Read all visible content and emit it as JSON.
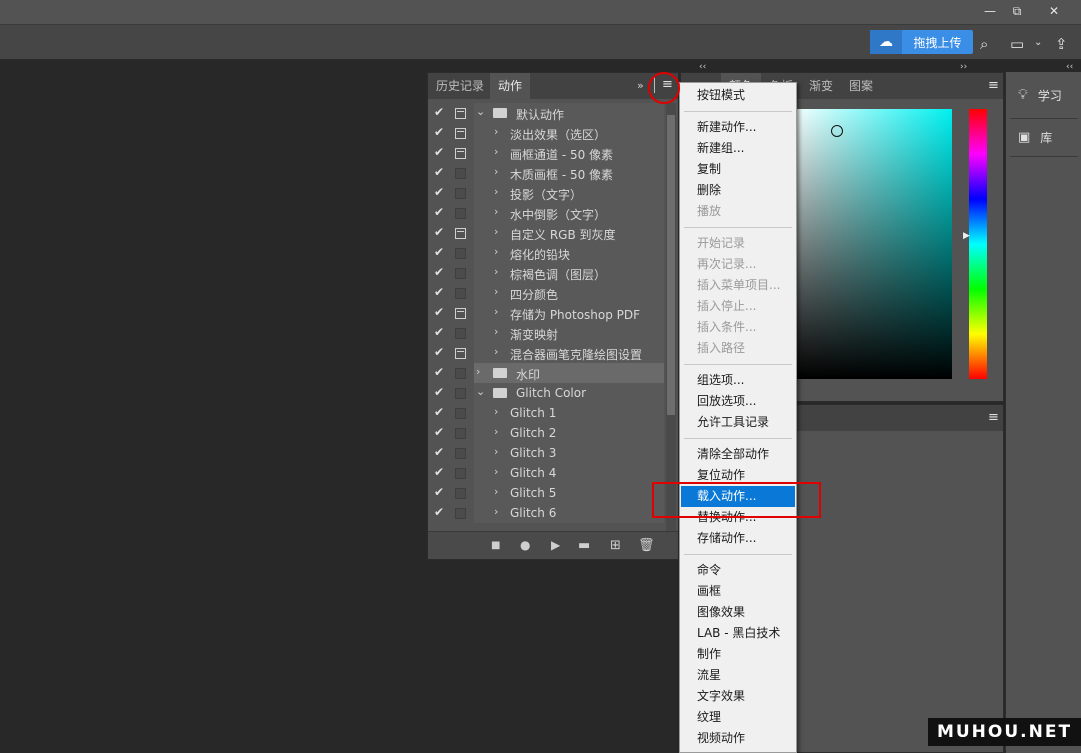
{
  "window": {
    "minimize": "—",
    "restore": "⧉",
    "close": "✕"
  },
  "options_bar": {
    "cloud_label": "拖拽上传"
  },
  "actions_panel": {
    "tabs": [
      "历史记录",
      "动作"
    ],
    "rows": [
      {
        "label": "默认动作",
        "checked": true,
        "dialog": true,
        "type": "set",
        "open": true
      },
      {
        "label": "淡出效果（选区）",
        "checked": true,
        "dialog": true,
        "type": "action"
      },
      {
        "label": "画框通道 - 50 像素",
        "checked": true,
        "dialog": true,
        "type": "action"
      },
      {
        "label": "木质画框 - 50 像素",
        "checked": true,
        "dialog": false,
        "type": "action"
      },
      {
        "label": "投影（文字）",
        "checked": true,
        "dialog": false,
        "type": "action"
      },
      {
        "label": "水中倒影（文字）",
        "checked": true,
        "dialog": false,
        "type": "action"
      },
      {
        "label": "自定义 RGB 到灰度",
        "checked": true,
        "dialog": true,
        "type": "action"
      },
      {
        "label": "熔化的铅块",
        "checked": true,
        "dialog": false,
        "type": "action"
      },
      {
        "label": "棕褐色调（图层）",
        "checked": true,
        "dialog": false,
        "type": "action"
      },
      {
        "label": "四分颜色",
        "checked": true,
        "dialog": false,
        "type": "action"
      },
      {
        "label": "存储为 Photoshop PDF",
        "checked": true,
        "dialog": true,
        "type": "action"
      },
      {
        "label": "渐变映射",
        "checked": true,
        "dialog": false,
        "type": "action"
      },
      {
        "label": "混合器画笔克隆绘图设置",
        "checked": true,
        "dialog": true,
        "type": "action"
      },
      {
        "label": "水印",
        "checked": true,
        "dialog": false,
        "type": "set",
        "open": false,
        "selected": true
      },
      {
        "label": "Glitch Color",
        "checked": true,
        "dialog": false,
        "type": "set",
        "open": true
      },
      {
        "label": "Glitch 1",
        "checked": true,
        "dialog": false,
        "type": "action"
      },
      {
        "label": "Glitch 2",
        "checked": true,
        "dialog": false,
        "type": "action"
      },
      {
        "label": "Glitch 3",
        "checked": true,
        "dialog": false,
        "type": "action"
      },
      {
        "label": "Glitch 4",
        "checked": true,
        "dialog": false,
        "type": "action"
      },
      {
        "label": "Glitch 5",
        "checked": true,
        "dialog": false,
        "type": "action"
      },
      {
        "label": "Glitch 6",
        "checked": true,
        "dialog": false,
        "type": "action"
      }
    ]
  },
  "color_panel": {
    "tabs": [
      "颜色",
      "色板",
      "渐变",
      "图案"
    ]
  },
  "right_dock": {
    "items": [
      "学习",
      "库"
    ]
  },
  "panel_menu": {
    "groups": [
      [
        {
          "label": "按钮模式",
          "enabled": true
        }
      ],
      [
        {
          "label": "新建动作...",
          "enabled": true
        },
        {
          "label": "新建组...",
          "enabled": true
        },
        {
          "label": "复制",
          "enabled": true
        },
        {
          "label": "删除",
          "enabled": true
        },
        {
          "label": "播放",
          "enabled": false
        }
      ],
      [
        {
          "label": "开始记录",
          "enabled": false
        },
        {
          "label": "再次记录...",
          "enabled": false
        },
        {
          "label": "插入菜单项目...",
          "enabled": false
        },
        {
          "label": "插入停止...",
          "enabled": false
        },
        {
          "label": "插入条件...",
          "enabled": false
        },
        {
          "label": "插入路径",
          "enabled": false
        }
      ],
      [
        {
          "label": "组选项...",
          "enabled": true
        },
        {
          "label": "回放选项...",
          "enabled": true
        },
        {
          "label": "允许工具记录",
          "enabled": true
        }
      ],
      [
        {
          "label": "清除全部动作",
          "enabled": true
        },
        {
          "label": "复位动作",
          "enabled": true
        },
        {
          "label": "载入动作...",
          "enabled": true,
          "highlighted": true
        },
        {
          "label": "替换动作...",
          "enabled": true
        },
        {
          "label": "存储动作...",
          "enabled": true
        }
      ],
      [
        {
          "label": "命令",
          "enabled": true
        },
        {
          "label": "画框",
          "enabled": true
        },
        {
          "label": "图像效果",
          "enabled": true
        },
        {
          "label": "LAB - 黑白技术",
          "enabled": true
        },
        {
          "label": "制作",
          "enabled": true
        },
        {
          "label": "流星",
          "enabled": true
        },
        {
          "label": "文字效果",
          "enabled": true
        },
        {
          "label": "纹理",
          "enabled": true
        },
        {
          "label": "视频动作",
          "enabled": true
        }
      ]
    ]
  },
  "watermark": "MUHOU.NET"
}
